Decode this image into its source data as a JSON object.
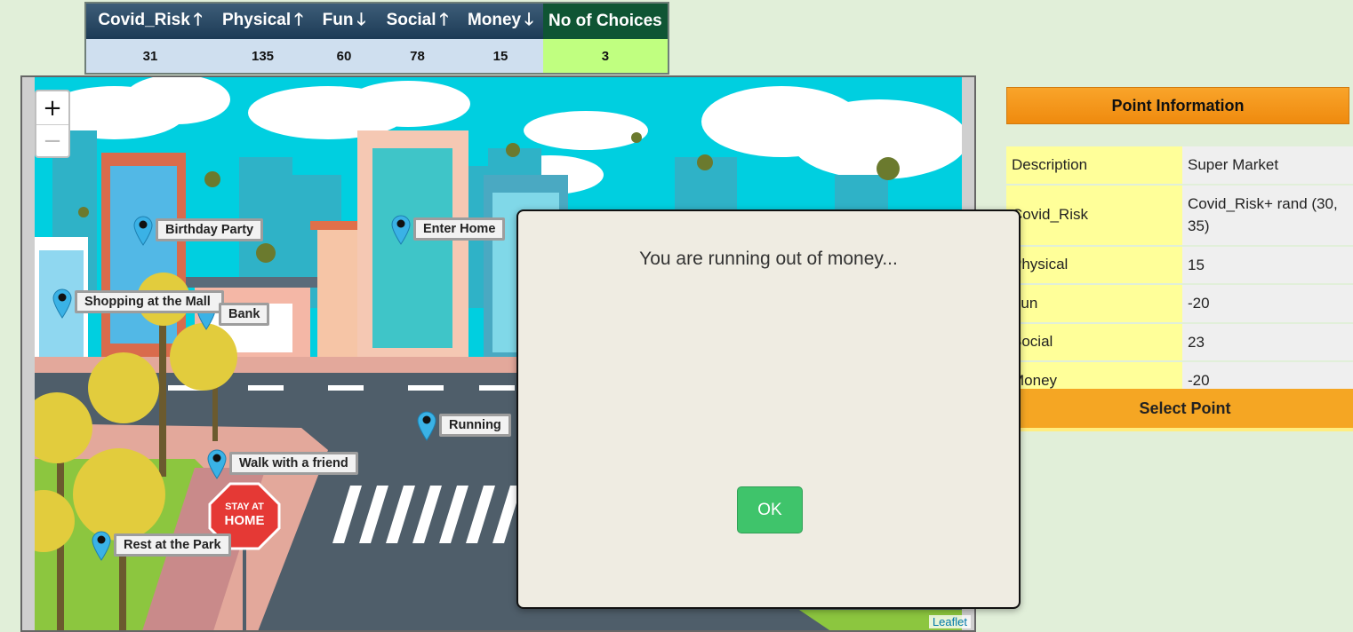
{
  "stats": {
    "headers": [
      {
        "label": "Covid_Risk",
        "arrow": "🡑"
      },
      {
        "label": "Physical",
        "arrow": "🡑"
      },
      {
        "label": "Fun",
        "arrow": "🡓"
      },
      {
        "label": "Social",
        "arrow": "🡑"
      },
      {
        "label": "Money",
        "arrow": "🡓"
      },
      {
        "label": "No of Choices",
        "arrow": ""
      }
    ],
    "values": [
      "31",
      "135",
      "60",
      "78",
      "15",
      "3"
    ]
  },
  "map": {
    "zoom_in": "+",
    "zoom_out": "−",
    "attribution": "Leaflet",
    "stop_sign_text": [
      "STAY AT",
      "HOME"
    ],
    "markers": [
      {
        "label": "Birthday Party"
      },
      {
        "label": "Enter Home"
      },
      {
        "label": "Shopping at the Mall"
      },
      {
        "label": "Bank"
      },
      {
        "label": "Running"
      },
      {
        "label": "Walk with a friend"
      },
      {
        "label": "Rest at the Park"
      }
    ]
  },
  "info": {
    "title": "Point Information",
    "rows": [
      {
        "key": "Description",
        "value": "Super Market"
      },
      {
        "key": "Covid_Risk",
        "value": "Covid_Risk+ rand (30, 35)"
      },
      {
        "key": "Physical",
        "value": "15"
      },
      {
        "key": "Fun",
        "value": "-20"
      },
      {
        "key": "Social",
        "value": "23"
      },
      {
        "key": "Money",
        "value": "-20"
      }
    ],
    "select_button": "Select Point"
  },
  "modal": {
    "message": "You are running out of money...",
    "ok_label": "OK"
  }
}
